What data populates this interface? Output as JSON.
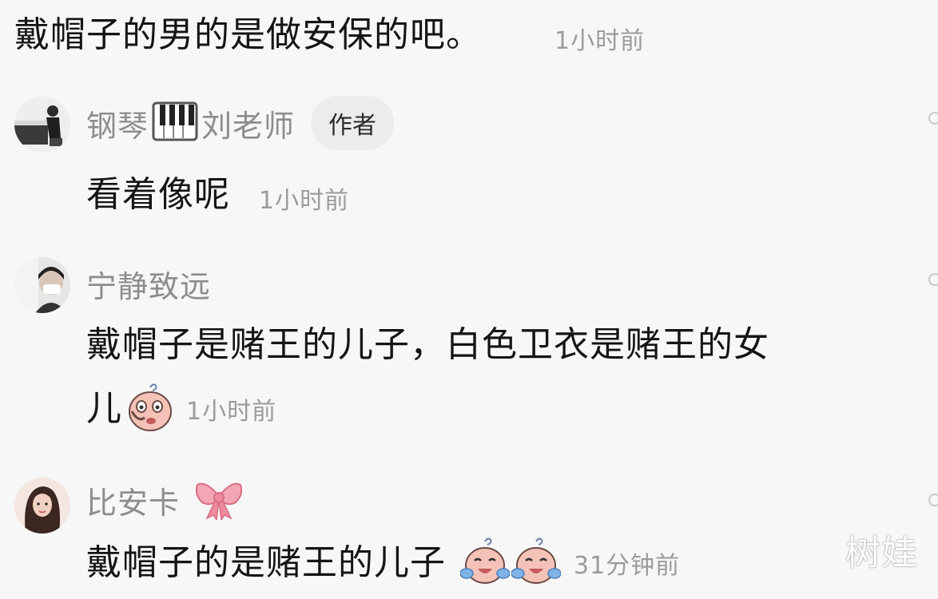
{
  "top_comment": {
    "text": "戴帽子的男的是做安保的吧。",
    "time": "1小时前"
  },
  "replies": [
    {
      "username_part1": "钢琴",
      "username_part2": "刘老师",
      "badge": "作者",
      "text": "看着像呢",
      "time": "1小时前",
      "avatar_icon": "piano-player-avatar",
      "name_icon": "piano-keys-icon"
    },
    {
      "username": "宁静致远",
      "text_line1": "戴帽子是赌王的儿子，白色卫衣是赌王的女",
      "text_line2": "儿",
      "time": "1小时前",
      "avatar_icon": "masked-woman-avatar",
      "emoji_icon": "crying-face-emoji"
    },
    {
      "username": "比安卡",
      "text": "戴帽子的是赌王的儿子",
      "time": "31分钟前",
      "avatar_icon": "woman-portrait-avatar",
      "name_icon": "bow-icon",
      "emoji_icons": [
        "crying-laugh-emoji",
        "crying-laugh-emoji"
      ]
    }
  ],
  "watermark": "树娃",
  "colors": {
    "background": "#f7f7f8",
    "text": "#151515",
    "muted": "#9b9b9b",
    "username": "#8d8d8d",
    "badge_bg": "#ececee",
    "bow": "#f08a9d"
  }
}
